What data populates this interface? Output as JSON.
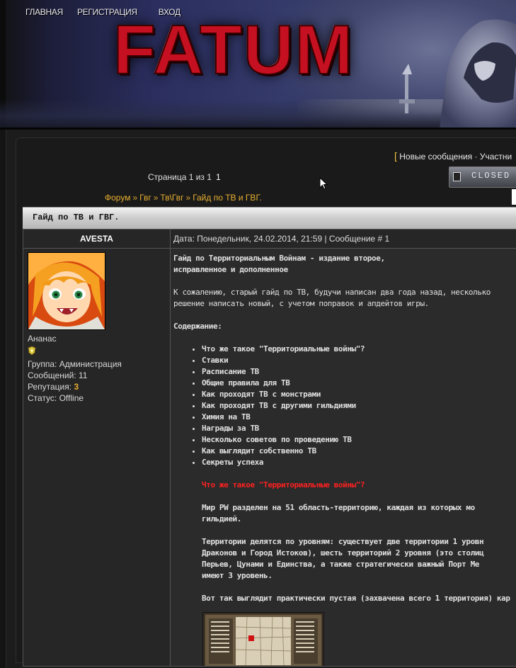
{
  "nav": {
    "home": "ГЛАВНАЯ",
    "register": "РЕГИСТРАЦИЯ",
    "login": "ВХОД"
  },
  "logo": "FATUM",
  "top_links": {
    "bracket": "[",
    "new_messages": "Новые сообщения",
    "separator": "·",
    "participants": "Участни"
  },
  "closed_button": "CLOSED",
  "pagination": {
    "label": "Страница 1 из 1",
    "current": "1"
  },
  "breadcrumb": [
    "Форум",
    "Гвг",
    "Тв\\Гвг",
    "Гайд по ТВ и ГВГ."
  ],
  "breadcrumb_sep": "»",
  "topic_title": "Гайд по ТВ и ГВГ.",
  "author": {
    "name": "AVESTA",
    "title": "Ананас",
    "group": "Группа: Администрация",
    "posts": "Сообщений: 11",
    "reputation_label": "Репутация: ",
    "reputation_value": "3",
    "status": "Статус: Offline"
  },
  "post_header": "Дата: Понедельник, 24.02.2014, 21:59 | Сообщение # 1",
  "post": {
    "title_line1": "Гайд по Территориальным Войнам - издание второе,",
    "title_line2": "исправленное и дополненное",
    "intro_line1": "К сожалению, старый гайд по ТВ, будучи написан два года назад, несколько",
    "intro_line2": "решение написать новый, с учетом поправок и апдейтов игры.",
    "contents_heading": "Содержание:",
    "toc": [
      "Что же такое \"Территориальные войны\"?",
      "Ставки",
      "Расписание ТВ",
      "Общие правила для ТВ",
      "Как проходят ТВ с монстрами",
      "Как проходят ТВ с другими гильдиями",
      "Химия на ТВ",
      "Награды за ТВ",
      "Несколько советов по проведению ТВ",
      "Как выглядит собственно ТВ",
      "Секреты успеха"
    ],
    "section_heading": "Что же такое \"Территориальные войны\"?",
    "para1_line1": "Мир PW разделен на 51 область-территорию, каждая из которых мо",
    "para1_line2": "гильдией.",
    "para2_line1": "Территории делятся по уровням: существует две территории 1 уровн",
    "para2_line2": "Драконов и Город Истоков), шесть территорий 2 уровня (это столиц",
    "para2_line3": "Перьев, Цунами и Единства, а также стратегически важный Порт Ме",
    "para2_line4": "имеют 3 уровень.",
    "para3_line1": "Вот так выглядит практически пустая (захвачена всего 1 территория) кар"
  }
}
